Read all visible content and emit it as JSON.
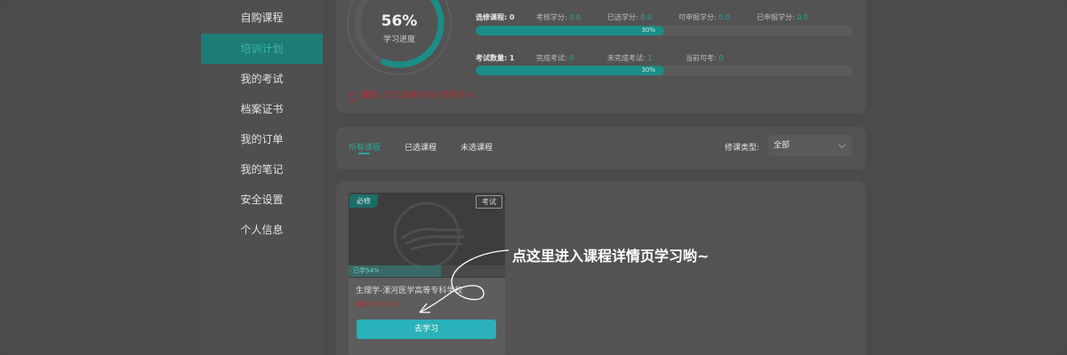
{
  "sidebar": {
    "items": [
      {
        "label": "自购课程",
        "active": false
      },
      {
        "label": "培训计划",
        "active": true
      },
      {
        "label": "我的考试",
        "active": false
      },
      {
        "label": "档案证书",
        "active": false
      },
      {
        "label": "我的订单",
        "active": false
      },
      {
        "label": "我的笔记",
        "active": false
      },
      {
        "label": "安全设置",
        "active": false
      },
      {
        "label": "个人信息",
        "active": false
      }
    ]
  },
  "progress": {
    "percent_text": "56%",
    "percent_value": 0.56,
    "label": "学习进度"
  },
  "elective": {
    "label": "选修课程:",
    "count": "0",
    "required_credit_label": "考核学分:",
    "required_credit": "0.0",
    "selected_credit_label": "已选学分:",
    "selected_credit": "0.0",
    "applicable_credit_label": "可申报学分:",
    "applicable_credit": "0.0",
    "applied_credit_label": "已申报学分:",
    "applied_credit": "0.0",
    "bar_percent_text": "30%",
    "bar_percent_value": 0.5
  },
  "exams": {
    "label": "考试数量:",
    "count": "1",
    "completed_label": "完成考试:",
    "completed": "0",
    "uncompleted_label": "未完成考试:",
    "uncompleted": "1",
    "available_label": "当前可考:",
    "available": "0",
    "bar_percent_text": "30%",
    "bar_percent_value": 0.5
  },
  "tip": {
    "icon": "!",
    "label": "提示:",
    "text": "您的选课已到达考核学分。"
  },
  "tabs": [
    {
      "label": "所有课程",
      "active": true
    },
    {
      "label": "已选课程",
      "active": false
    },
    {
      "label": "未选课程",
      "active": false
    }
  ],
  "filter": {
    "label": "修课类型:",
    "value": "全部"
  },
  "course_card": {
    "required_badge": "必修",
    "exam_badge": "考试",
    "progress_text": "已学54%",
    "progress_value": 0.59,
    "title": "生理学-漯河医学高等专科学校",
    "credit": "国家I类5.0学分",
    "button_label": "去学习"
  },
  "guide": {
    "text": "点这里进入课程详情页学习哟~"
  },
  "colors": {
    "accent": "#1b8d85",
    "accent_text": "#2aa79b",
    "button": "#2ab1b9",
    "warning": "#b0303a"
  }
}
